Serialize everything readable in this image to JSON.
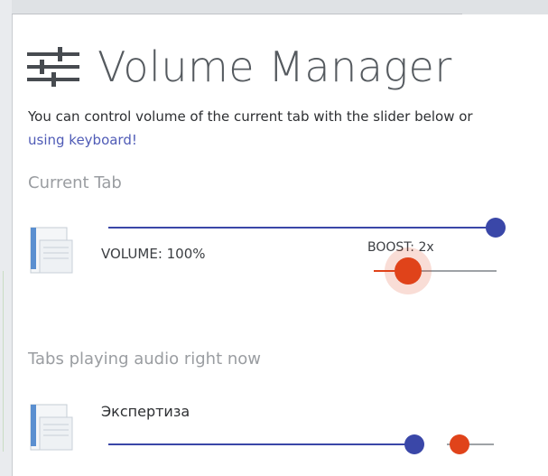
{
  "header": {
    "title": "Volume Manager",
    "icon": "sliders-icon"
  },
  "intro": {
    "text_before": "You can control volume of the current tab with the slider below or ",
    "link_text": "using keyboard!"
  },
  "current_tab": {
    "heading": "Current Tab",
    "icon": "document-icon",
    "volume_label": "VOLUME: 100%",
    "volume_level": 1.0,
    "boost_label": "BOOST: 2x",
    "boost_level": 0.28
  },
  "playing_tabs": {
    "heading": "Tabs playing audio right now",
    "items": [
      {
        "title": "Экспертиза",
        "icon": "document-icon"
      }
    ]
  },
  "colors": {
    "volume_accent": "#3a47a8",
    "boost_accent": "#e0431a",
    "heading_gray": "#9a9da1"
  }
}
